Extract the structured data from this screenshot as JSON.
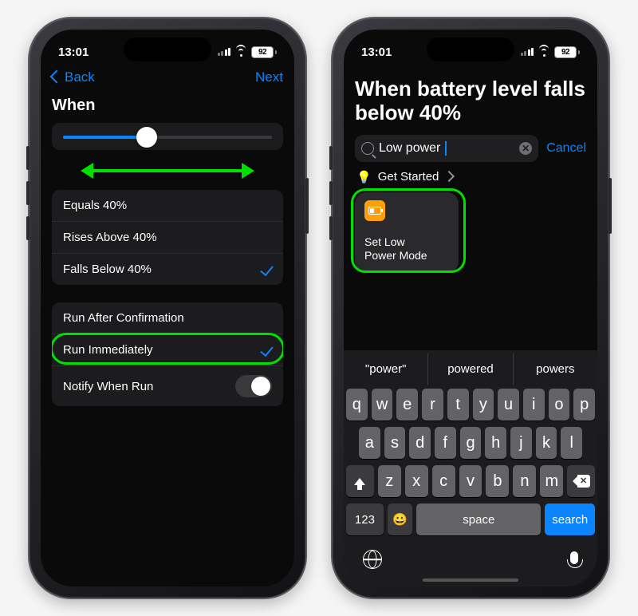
{
  "status": {
    "time": "13:01",
    "battery_pct": "92"
  },
  "left": {
    "nav": {
      "back": "Back",
      "next": "Next"
    },
    "title": "When",
    "slider_pct": 40,
    "conditions": [
      {
        "label": "Equals 40%",
        "checked": false
      },
      {
        "label": "Rises Above 40%",
        "checked": false
      },
      {
        "label": "Falls Below 40%",
        "checked": true
      }
    ],
    "run_options": [
      {
        "label": "Run After Confirmation",
        "type": "row",
        "checked": false
      },
      {
        "label": "Run Immediately",
        "type": "row",
        "checked": true
      },
      {
        "label": "Notify When Run",
        "type": "toggle",
        "on": false
      }
    ]
  },
  "right": {
    "title": "When battery level falls below 40%",
    "search": {
      "value": "Low power",
      "placeholder": "",
      "cancel": "Cancel"
    },
    "section_header": "Get Started",
    "tile": {
      "label_l1": "Set Low",
      "label_l2": "Power Mode"
    },
    "suggestions": [
      "\"power\"",
      "powered",
      "powers"
    ],
    "keyboard": {
      "row1": [
        "q",
        "w",
        "e",
        "r",
        "t",
        "y",
        "u",
        "i",
        "o",
        "p"
      ],
      "row2": [
        "a",
        "s",
        "d",
        "f",
        "g",
        "h",
        "j",
        "k",
        "l"
      ],
      "row3": [
        "z",
        "x",
        "c",
        "v",
        "b",
        "n",
        "m"
      ],
      "num_key": "123",
      "space": "space",
      "search": "search"
    }
  }
}
